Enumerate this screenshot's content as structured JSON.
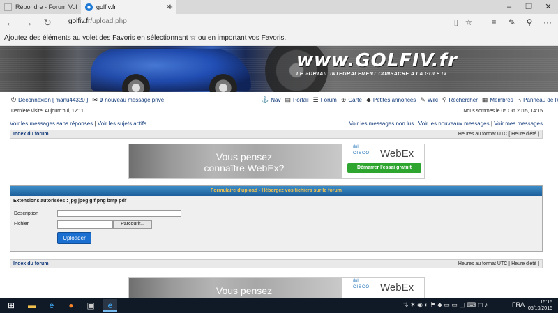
{
  "browser": {
    "tabs": [
      {
        "label": "Répondre - Forum Volkswag",
        "active": false
      },
      {
        "label": "golfiv.fr",
        "active": true
      }
    ],
    "url_host": "golfiv.fr",
    "url_path": "/upload.php",
    "favorites_hint": "Ajoutez des éléments au volet des Favoris en sélectionnant ☆ ou en important vos Favoris."
  },
  "banner": {
    "logo": "www.GOLFIV.fr",
    "tagline": "LE PORTAIL INTEGRALEMENT CONSACRE A LA GOLF IV"
  },
  "header": {
    "logout": "Déconnexion [ manu44320 ]",
    "pm_count": "0",
    "pm_text": "nouveau message privé",
    "nav": [
      "Nav",
      "Portail",
      "Forum",
      "Carte",
      "Petites annonces",
      "Wiki",
      "Rechercher",
      "Membres",
      "Panneau de l'utilisateur"
    ],
    "last_visit": "Dernière visite: Aujourd'hui, 12:11",
    "current_date": "Nous sommes le 05 Oct 2015, 14:15",
    "left_links": [
      "Voir les messages sans réponses",
      "Voir les sujets actifs"
    ],
    "right_links": [
      "Voir les messages non lus",
      "Voir les nouveaux messages",
      "Voir mes messages"
    ]
  },
  "navbar": {
    "index": "Index du forum",
    "tz": "Heures au format UTC [ Heure d'été ]"
  },
  "ad": {
    "headline_1": "Vous pensez",
    "headline_2": "connaître WebEx?",
    "brand_small": "CISCO",
    "brand": "WebEx",
    "cta": "Démarrer l'essai gratuit"
  },
  "form": {
    "title": "Formulaire d'upload - Hébergez vos fichiers sur le forum",
    "extensions": "Extensions autorisées : jpg jpeg gif png bmp pdf",
    "description_label": "Description",
    "file_label": "Fichier",
    "browse_label": "Parcourir...",
    "upload_label": "Uploader"
  },
  "taskbar": {
    "language": "FRA",
    "time": "15:15",
    "date": "05/10/2015"
  },
  "colors": {
    "link": "#123a7a",
    "form_head": "#1d5f9b",
    "form_title": "#f7c34a",
    "upload_button": "#1a6fd1",
    "taskbar": "#101a27"
  }
}
